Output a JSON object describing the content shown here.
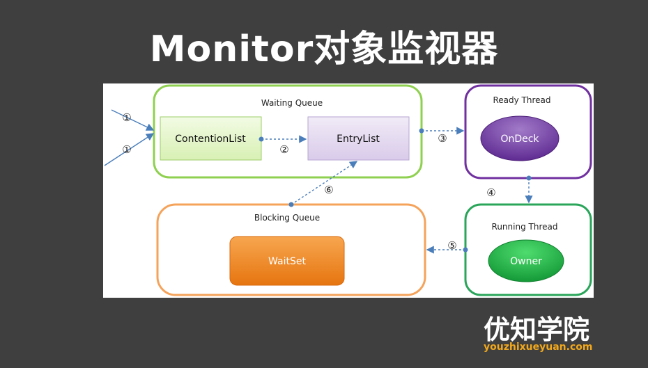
{
  "title": "Monitor对象监视器",
  "brand": {
    "name": "优知学院",
    "domain": "youzhixueyuan.com"
  },
  "diagram": {
    "groups": {
      "waiting_queue": "Waiting Queue",
      "ready_thread": "Ready Thread",
      "blocking_queue": "Blocking Queue",
      "running_thread": "Running Thread"
    },
    "nodes": {
      "contention_list": "ContentionList",
      "entry_list": "EntryList",
      "on_deck": "OnDeck",
      "wait_set": "WaitSet",
      "owner": "Owner"
    },
    "steps": {
      "s1a": "①",
      "s1b": "①",
      "s2": "②",
      "s3": "③",
      "s4": "④",
      "s5": "⑤",
      "s6": "⑥"
    }
  },
  "colors": {
    "waiting_border": "#8fd050",
    "ready_border": "#7030a0",
    "blocking_border": "#f5a35b",
    "running_border": "#2aa55a",
    "arrow": "#4a7ebb"
  }
}
